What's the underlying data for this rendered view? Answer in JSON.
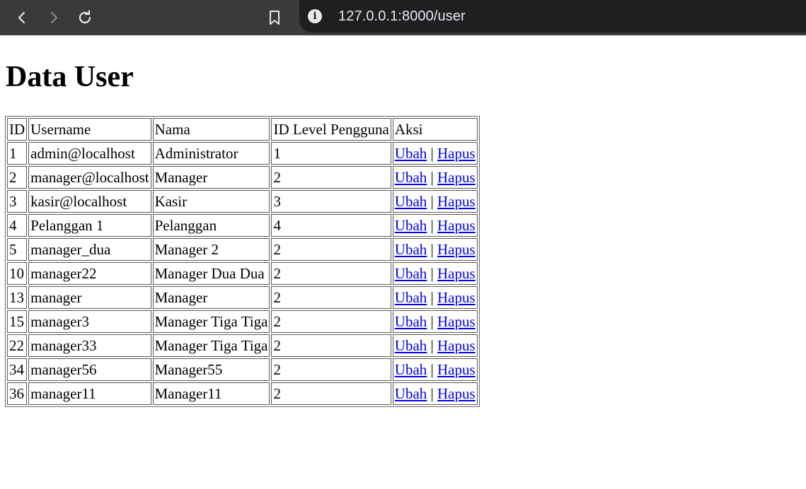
{
  "browser": {
    "url": "127.0.0.1:8000/user",
    "icons": [
      "back-icon",
      "forward-icon",
      "reload-icon",
      "bookmark-icon",
      "site-info-icon"
    ]
  },
  "page": {
    "title": "Data User",
    "table": {
      "headers": [
        "ID",
        "Username",
        "Nama",
        "ID Level Pengguna",
        "Aksi"
      ],
      "rows": [
        {
          "id": "1",
          "username": "admin@localhost",
          "nama": "Administrator",
          "level": "1",
          "edit": "Ubah",
          "sep": "|",
          "delete": "Hapus"
        },
        {
          "id": "2",
          "username": "manager@localhost",
          "nama": "Manager",
          "level": "2",
          "edit": "Ubah",
          "sep": "|",
          "delete": "Hapus"
        },
        {
          "id": "3",
          "username": "kasir@localhost",
          "nama": "Kasir",
          "level": "3",
          "edit": "Ubah",
          "sep": "|",
          "delete": "Hapus"
        },
        {
          "id": "4",
          "username": "Pelanggan 1",
          "nama": "Pelanggan",
          "level": "4",
          "edit": "Ubah",
          "sep": "|",
          "delete": "Hapus"
        },
        {
          "id": "5",
          "username": "manager_dua",
          "nama": "Manager 2",
          "level": "2",
          "edit": "Ubah",
          "sep": "|",
          "delete": "Hapus"
        },
        {
          "id": "10",
          "username": "manager22",
          "nama": "Manager Dua Dua",
          "level": "2",
          "edit": "Ubah",
          "sep": "|",
          "delete": "Hapus"
        },
        {
          "id": "13",
          "username": "manager",
          "nama": "Manager",
          "level": "2",
          "edit": "Ubah",
          "sep": "|",
          "delete": "Hapus"
        },
        {
          "id": "15",
          "username": "manager3",
          "nama": "Manager Tiga Tiga",
          "level": "2",
          "edit": "Ubah",
          "sep": "|",
          "delete": "Hapus"
        },
        {
          "id": "22",
          "username": "manager33",
          "nama": "Manager Tiga Tiga",
          "level": "2",
          "edit": "Ubah",
          "sep": "|",
          "delete": "Hapus"
        },
        {
          "id": "34",
          "username": "manager56",
          "nama": "Manager55",
          "level": "2",
          "edit": "Ubah",
          "sep": "|",
          "delete": "Hapus"
        },
        {
          "id": "36",
          "username": "manager11",
          "nama": "Manager11",
          "level": "2",
          "edit": "Ubah",
          "sep": "|",
          "delete": "Hapus"
        }
      ]
    }
  },
  "colors": {
    "toolbar": "#3a3a3d",
    "omnibox": "#1f1f22",
    "link": "#0000ee"
  }
}
